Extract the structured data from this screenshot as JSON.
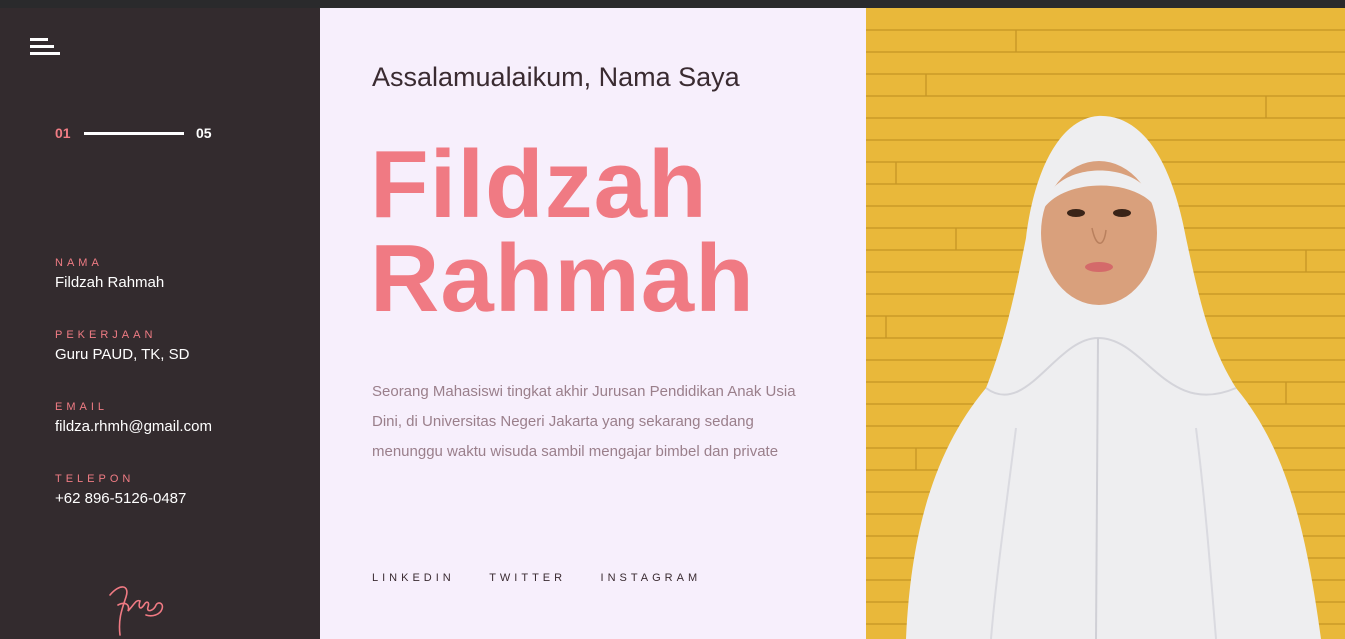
{
  "sidebar": {
    "pager": {
      "current": "01",
      "total": "05"
    },
    "info": [
      {
        "label": "NAMA",
        "value": "Fildzah Rahmah"
      },
      {
        "label": "PEKERJAAN",
        "value": "Guru PAUD, TK, SD"
      },
      {
        "label": "EMAIL",
        "value": "fildza.rhmh@gmail.com"
      },
      {
        "label": "TELEPON",
        "value": "+62 896-5126-0487"
      }
    ]
  },
  "main": {
    "greeting": "Assalamualaikum, Nama Saya",
    "first_name": "Fildzah",
    "last_name": "Rahmah",
    "description": "Seorang Mahasiswi tingkat akhir Jurusan Pendidikan Anak Usia Dini, di Universitas Negeri Jakarta yang sekarang sedang menunggu waktu wisuda sambil mengajar bimbel dan private",
    "socials": [
      "LINKEDIN",
      "TWITTER",
      "INSTAGRAM"
    ]
  },
  "colors": {
    "accent": "#f07a83",
    "sidebar_bg": "#332b2e",
    "content_bg": "#f7effc",
    "photo_bg": "#e8b838"
  },
  "icons": {
    "menu": "hamburger-menu-icon",
    "signature": "signature-icon"
  }
}
